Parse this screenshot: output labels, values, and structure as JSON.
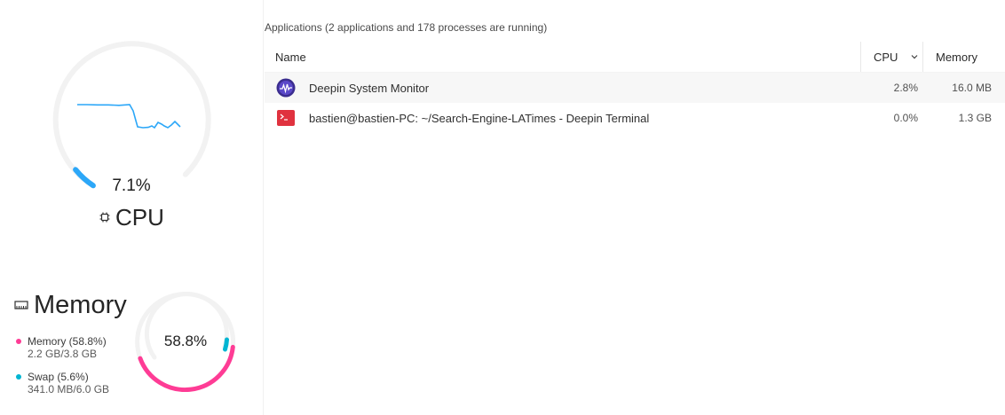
{
  "colors": {
    "cpu_accent": "#2ca7f8",
    "memory_accent": "#fe3c95",
    "swap_accent": "#00b5d2",
    "track": "#f2f2f2"
  },
  "cpu": {
    "percent_text": "7.1%",
    "percent": 7.1,
    "title": "CPU",
    "icon": "cpu-chip-icon"
  },
  "memory": {
    "title": "Memory",
    "icon": "ram-module-icon",
    "percent_text": "58.8%",
    "memory_percent": 58.8,
    "swap_percent": 5.6,
    "legend": [
      {
        "label": "Memory (58.8%)",
        "detail": "2.2 GB/3.8 GB"
      },
      {
        "label": "Swap (5.6%)",
        "detail": "341.0 MB/6.0 GB"
      }
    ]
  },
  "applications": {
    "title": "Applications (2 applications and 178 processes are running)",
    "columns": {
      "name": "Name",
      "cpu": "CPU",
      "memory": "Memory"
    },
    "sort_icon": "chevron-down-icon",
    "rows": [
      {
        "name": "Deepin System Monitor",
        "cpu": "2.8%",
        "memory": "16.0 MB",
        "icon": "system-monitor-icon"
      },
      {
        "name": "bastien@bastien-PC: ~/Search-Engine-LATimes - Deepin Terminal",
        "cpu": "0.0%",
        "memory": "1.3 GB",
        "icon": "terminal-icon"
      }
    ]
  }
}
